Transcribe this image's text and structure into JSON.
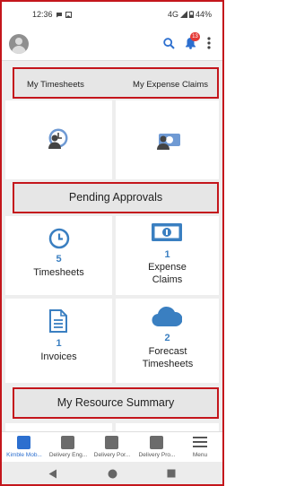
{
  "status_bar": {
    "time": "12:36",
    "network": "4G",
    "battery": "44%"
  },
  "app_bar": {
    "notification_count": "13"
  },
  "tabs": {
    "my_timesheets": "My Timesheets",
    "my_expense_claims": "My Expense Claims"
  },
  "pending_approvals": {
    "title": "Pending Approvals",
    "tiles": [
      {
        "count": "5",
        "label": "Timesheets"
      },
      {
        "count": "1",
        "label": "Expense Claims"
      },
      {
        "count": "1",
        "label": "Invoices"
      },
      {
        "count": "2",
        "label": "Forecast Timesheets"
      }
    ]
  },
  "resource_summary": {
    "title": "My Resource Summary"
  },
  "bottom_nav": [
    {
      "label": "Kimble Mob...",
      "active": true
    },
    {
      "label": "Delivery Eng...",
      "active": false
    },
    {
      "label": "Delivery Por...",
      "active": false
    },
    {
      "label": "Delivery Pro...",
      "active": false
    },
    {
      "label": "Menu",
      "active": false
    }
  ],
  "colors": {
    "accent": "#3a7fc1",
    "highlight_border": "#c4161c",
    "active_nav": "#2c6fcf"
  }
}
